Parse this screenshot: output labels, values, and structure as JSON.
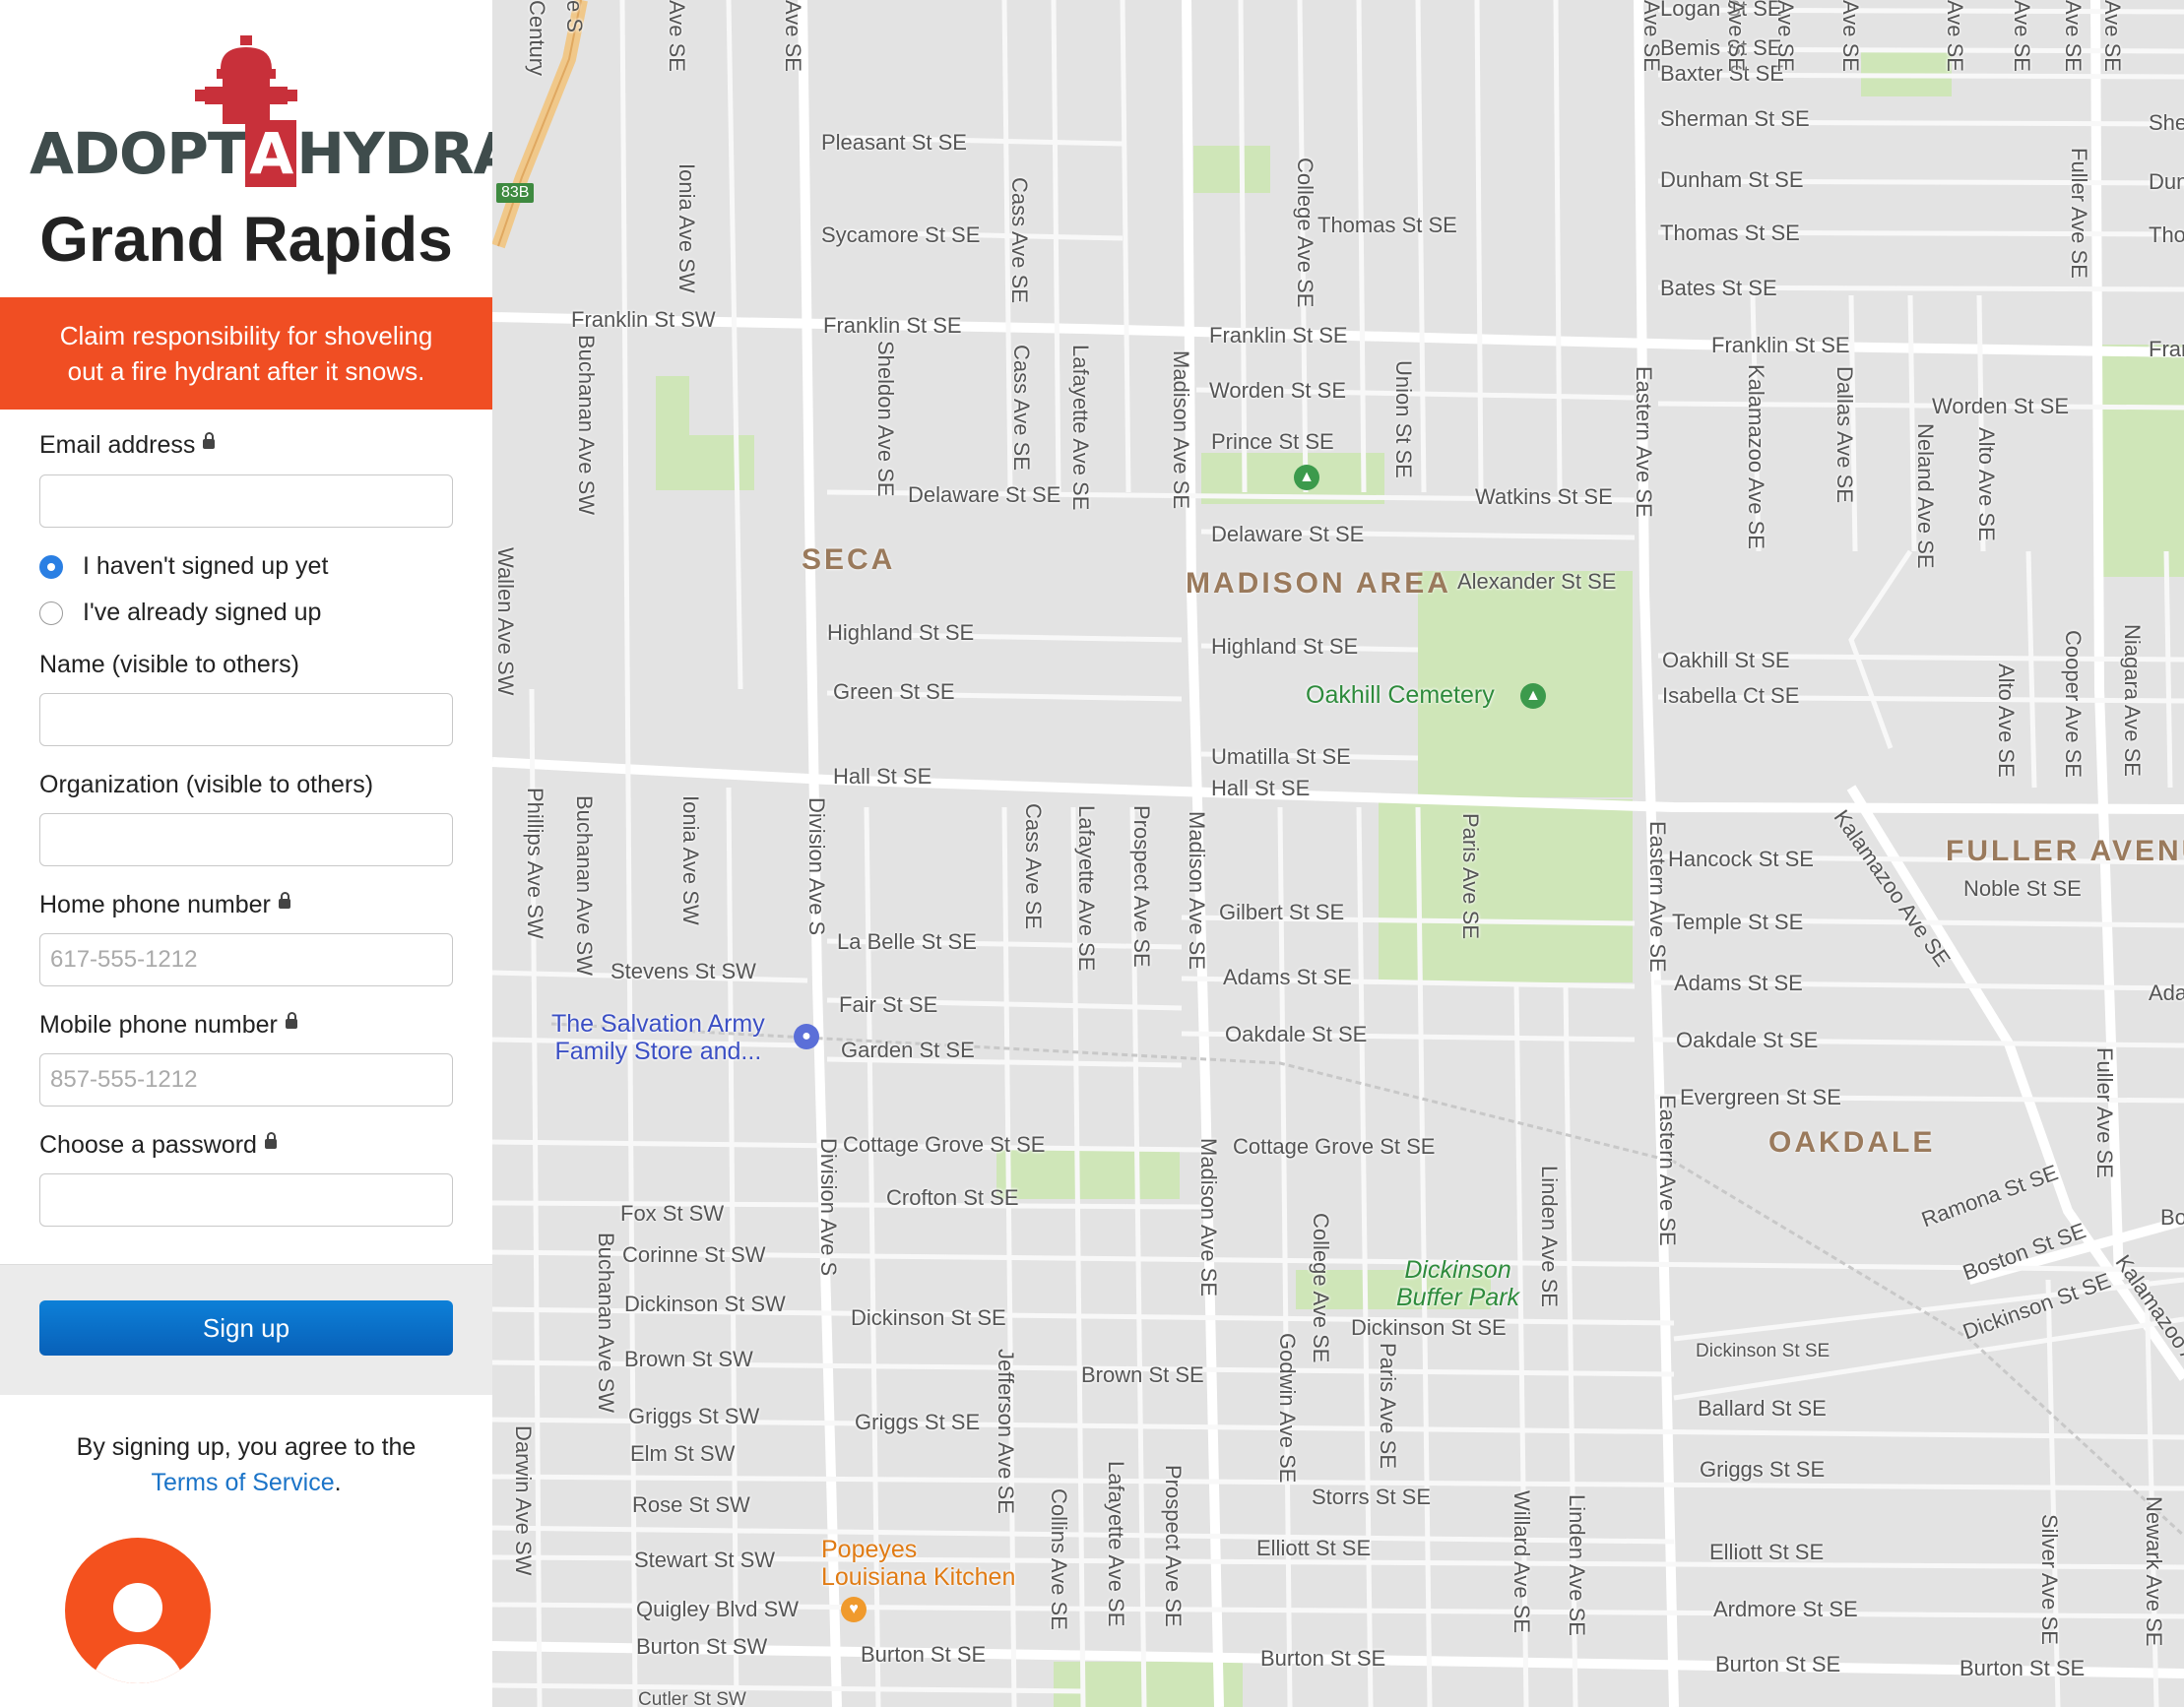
{
  "sidebar": {
    "logo": {
      "part1": "ADOPT",
      "part2": "A",
      "part3": "HYDRANT"
    },
    "city": "Grand Rapids",
    "banner": "Claim responsibility for shoveling out a fire hydrant after it snows.",
    "form": {
      "email_label": "Email address",
      "email_value": "",
      "radio_new": "I haven't signed up yet",
      "radio_existing": "I've already signed up",
      "selected": "new",
      "name_label": "Name (visible to others)",
      "org_label": "Organization (visible to others)",
      "home_phone_label": "Home phone number",
      "home_phone_placeholder": "617-555-1212",
      "mobile_phone_label": "Mobile phone number",
      "mobile_phone_placeholder": "857-555-1212",
      "password_label": "Choose a password",
      "submit": "Sign up"
    },
    "terms_prefix": "By signing up, you agree to the",
    "terms_link": "Terms of Service",
    "terms_suffix": ".",
    "colors": {
      "banner": "#f04e23",
      "button": "#0a6fc9",
      "logo_red": "#c8303a"
    }
  },
  "map": {
    "neighborhoods": [
      "SECA",
      "MADISON AREA",
      "OAKDALE",
      "FULLER AVENU"
    ],
    "pois": [
      {
        "name": "The Salvation Army Family Store and...",
        "line1": "The Salvation Army",
        "line2": "Family Store and...",
        "icon": "shopping-bag-icon",
        "color": "#3b4fc4"
      },
      {
        "name": "Oakhill Cemetery",
        "icon": "park-icon",
        "color": "#2e8b3c"
      },
      {
        "name": "Dickinson Buffer Park",
        "line1": "Dickinson",
        "line2": "Buffer Park",
        "icon": "park-icon",
        "color": "#2e8b3c"
      },
      {
        "name": "Popeyes Louisiana Kitchen",
        "line1": "Popeyes",
        "line2": "Louisiana Kitchen",
        "icon": "restaurant-icon",
        "color": "#e07b14"
      }
    ],
    "highway_shield": "83B",
    "streets": {
      "horizontal": [
        "Logan St SE",
        "Bemis St SE",
        "Baxter St SE",
        "Sherman St SE",
        "Dunham St SE",
        "Pleasant St SE",
        "Sycamore St SE",
        "Thomas St SE",
        "Thomas St SE",
        "Bates St SE",
        "Franklin St SW",
        "Franklin St SE",
        "Franklin St SE",
        "Franklin St SE",
        "Worden St SE",
        "Worden St SE",
        "Prince St SE",
        "Delaware St SE",
        "Watkins St SE",
        "Delaware St SE",
        "Alexander St SE",
        "Highland St SE",
        "Highland St SE",
        "Oakhill St SE",
        "Isabella Ct SE",
        "Green St SE",
        "Umatilla St SE",
        "Hall St SE",
        "Hall St SE",
        "Hancock St SE",
        "Noble St SE",
        "Gilbert St SE",
        "Temple St SE",
        "La Belle St SE",
        "Stevens St SW",
        "Adams St SE",
        "Adams St SE",
        "Fair St SE",
        "Oakdale St SE",
        "Oakdale St SE",
        "Garden St SE",
        "Evergreen St SE",
        "Cottage Grove St SE",
        "Cottage Grove St SE",
        "Fox St SW",
        "Crofton St SE",
        "Corinne St SW",
        "Dickinson St SW",
        "Dickinson St SE",
        "Dickinson St SE",
        "Dickinson St SE",
        "Brown St SW",
        "Brown St SE",
        "Ballard St SE",
        "Griggs St SW",
        "Griggs St SE",
        "Griggs St SE",
        "Elm St SW",
        "Rose St SW",
        "Storrs St SE",
        "Elliott St SE",
        "Elliott St SE",
        "Stewart St SW",
        "Ardmore St SE",
        "Quigley Blvd SW",
        "Burton St SW",
        "Burton St SE",
        "Burton St SE",
        "Burton St SE",
        "Burton St SE",
        "Cutler St SW",
        "Sherma",
        "Dunhar",
        "Thoma",
        "Frankli",
        "Ada",
        "Bo"
      ],
      "vertical": [
        "Century",
        "Ionia Ave SW",
        "Buchanan Ave SW",
        "Wallen Ave SW",
        "Cass Ave SE",
        "Sheldon Ave SE",
        "Cass Ave SE",
        "Lafayette Ave SE",
        "Madison Ave SE",
        "College Ave SE",
        "Union St SE",
        "Eastern Ave SE",
        "Kalamazoo Ave SE",
        "Dallas Ave SE",
        "Neland Ave SE",
        "Alto Ave SE",
        "Fuller Ave SE",
        "Phillips Ave SW",
        "Buchanan Ave SW",
        "Ionia Ave SW",
        "Division Ave S",
        "Cass Ave SE",
        "Lafayette Ave SE",
        "Prospect Ave SE",
        "Madison Ave SE",
        "Paris Ave SE",
        "Eastern Ave SE",
        "Alto Ave SE",
        "Cooper Ave SE",
        "Niagara Ave SE",
        "Kalamazoo Ave SE",
        "Fuller Ave SE",
        "Division Ave S",
        "Madison Ave SE",
        "College Ave SE",
        "Linden Ave SE",
        "Eastern Ave SE",
        "Buchanan Ave SW",
        "Godwin Ave SE",
        "Paris Ave SE",
        "Jefferson Ave SE",
        "Darwin Ave SW",
        "Collins Ave SE",
        "Lafayette Ave SE",
        "Prospect Ave SE",
        "Willard Ave SE",
        "Linden Ave SE",
        "Silver Ave SE",
        "Newark Ave SE",
        "Kalamazoo Ave SE",
        "Ave SE",
        "Ave SE",
        "Ave SE",
        "Ave SE",
        "Ave SE",
        "Ave SE",
        "Ave SE",
        "Ave SE",
        "Ave SE",
        "Ave SE",
        "e S"
      ]
    }
  }
}
